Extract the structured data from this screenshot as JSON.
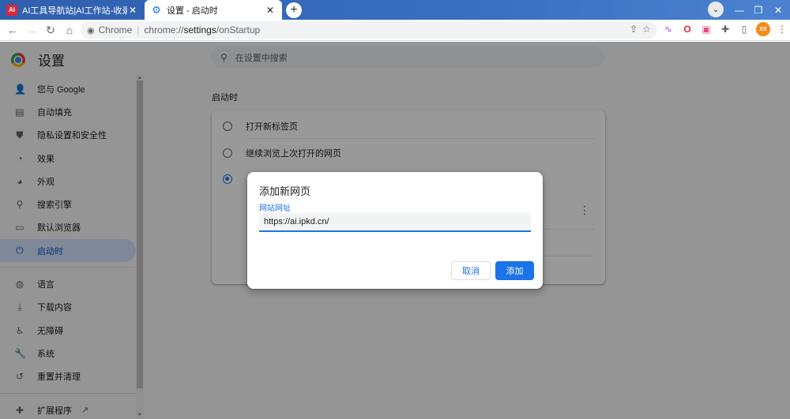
{
  "tabs": [
    {
      "title": "AI工具导航站|AI工作站-收录全球",
      "favicon": "AI"
    },
    {
      "title": "设置 - 启动时"
    }
  ],
  "omnibox": {
    "site": "Chrome",
    "url_prefix": "chrome://",
    "url_host": "settings",
    "url_path": "/onStartup"
  },
  "profile": {
    "initials": "XX"
  },
  "sidebar": {
    "title": "设置",
    "items": [
      {
        "label": "您与 Google",
        "icon": "person-icon"
      },
      {
        "label": "自动填充",
        "icon": "clipboard-icon"
      },
      {
        "label": "隐私设置和安全性",
        "icon": "shield-icon"
      },
      {
        "label": "效果",
        "icon": "speedometer-icon"
      },
      {
        "label": "外观",
        "icon": "palette-icon"
      },
      {
        "label": "搜索引擎",
        "icon": "search-icon"
      },
      {
        "label": "默认浏览器",
        "icon": "browser-icon"
      },
      {
        "label": "启动时",
        "icon": "power-icon"
      }
    ],
    "items_secondary": [
      {
        "label": "语言",
        "icon": "globe-icon"
      },
      {
        "label": "下载内容",
        "icon": "download-icon"
      },
      {
        "label": "无障碍",
        "icon": "accessibility-icon"
      },
      {
        "label": "系统",
        "icon": "wrench-icon"
      },
      {
        "label": "重置并清理",
        "icon": "history-icon"
      }
    ],
    "extensions": {
      "label": "扩展程序",
      "icon": "puzzle-icon"
    }
  },
  "search": {
    "placeholder": "在设置中搜索"
  },
  "section": {
    "title": "启动时"
  },
  "startup_options": [
    {
      "label": "打开新标签页"
    },
    {
      "label": "继续浏览上次打开的网页"
    }
  ],
  "dialog": {
    "title": "添加新网页",
    "field_label": "网站网址",
    "field_value": "https://ai.ipkd.cn/",
    "cancel_label": "取消",
    "add_label": "添加"
  }
}
